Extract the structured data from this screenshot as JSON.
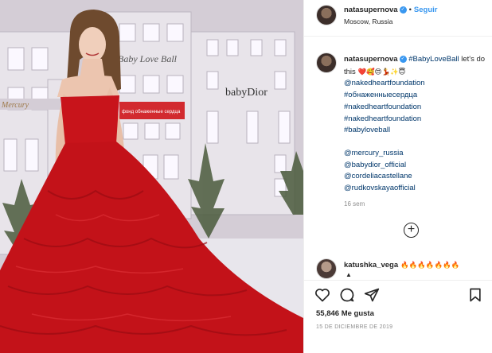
{
  "post": {
    "username": "natasupernova",
    "follow_label": "Seguir",
    "dot": "•",
    "location": "Moscow, Russia"
  },
  "caption": {
    "username": "natasupernova",
    "first_tag": "#BabyLoveBall",
    "first_text": " let's do this",
    "emojis": "❤️🥰😍💃✨😇",
    "hashtags": [
      "@nakedheartfoundation",
      "#обнаженныесердца",
      "#nakedheartfoundation",
      "#nakedheartfoundation",
      "#babyloveball"
    ],
    "mentions": [
      "@mercury_russia",
      "@babydior_official",
      "@cordeliacastellane",
      "@rudkovskayaofficial"
    ],
    "age": "16 sem"
  },
  "load_more_icon": "plus-circle-icon",
  "comment": {
    "username": "katushka_vega",
    "text": "🔥🔥🔥🔥🔥🔥🔥"
  },
  "actions": {
    "like_icon": "heart-icon",
    "comment_icon": "comment-bubble-icon",
    "share_icon": "share-plane-icon",
    "save_icon": "bookmark-icon",
    "likes": "55,846 Me gusta",
    "date": "15 DE DICIEMBRE DE 2019"
  },
  "photo": {
    "sign_text": "Baby Love Ball",
    "brand_text": "babyDior",
    "banner_text": "фонд обнаженные сердца",
    "left_sign": "Mercury"
  },
  "colors": {
    "link": "#00376b",
    "accent_blue": "#3897f0",
    "dress_red": "#c8141b"
  }
}
